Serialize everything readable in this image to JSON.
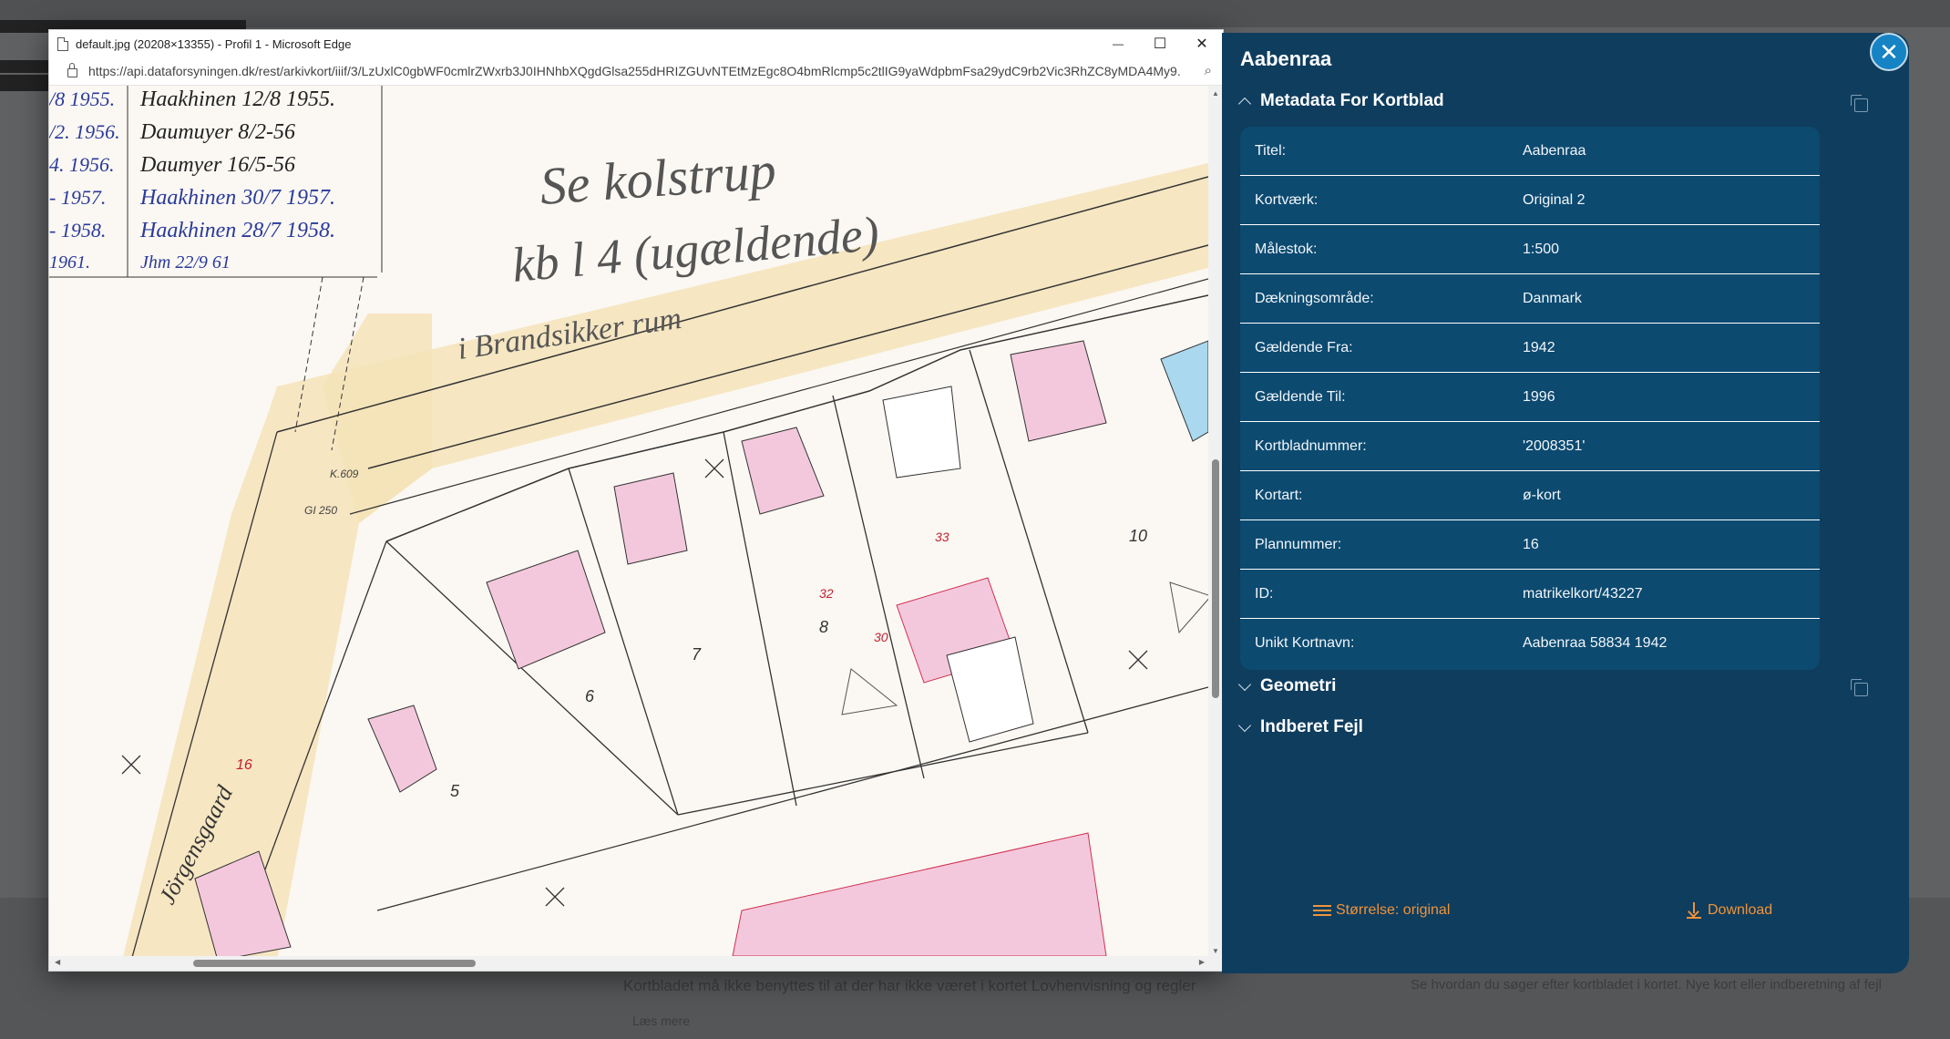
{
  "browser": {
    "title": "default.jpg (20208×13355) - Profil 1 - Microsoft Edge",
    "url": "https://api.dataforsyningen.dk/rest/arkivkort/iiif/3/LzUxlC0gbWF0cmlrZWxrb3J0IHNhbXQgdGlsa255dHRIZGUvNTEtMzEgc8O4bmRlcmp5c2tlIG9yaWdpbmFsa29ydC9rb2Vic3RhZC8yMDA4My9...",
    "controls": {
      "minimize": "—",
      "maximize": "☐",
      "close": "✕"
    }
  },
  "map": {
    "heading": "Se kolstrup",
    "subheading": "kb l 4 (ugældende)",
    "note": "i Brandsikker rum",
    "street": "Jörgensgaard",
    "plots": [
      "6",
      "7",
      "8",
      "10",
      "5",
      "16"
    ],
    "small_labels": [
      "32",
      "30",
      "33",
      "K.609",
      "GI 250"
    ],
    "log_entries": [
      {
        "date": "/8 1955.",
        "sign": "Haakhinen 12/8 1955."
      },
      {
        "date": "/2. 1956.",
        "sign": "Daumuyer 8/2-56"
      },
      {
        "date": "4. 1956.",
        "sign": "Daumyer 16/5-56"
      },
      {
        "date": "- 1957.",
        "sign": "Haakhinen 30/7 1957."
      },
      {
        "date": "- 1958.",
        "sign": "Haakhinen 28/7 1958."
      },
      {
        "date": "1961.",
        "sign": "Jhm 22/9 61"
      }
    ]
  },
  "panel": {
    "title": "Aabenraa",
    "sections": {
      "metadata": "Metadata For Kortblad",
      "geometry": "Geometri",
      "errors": "Indberet Fejl"
    },
    "rows": [
      {
        "key": "Titel:",
        "value": "Aabenraa"
      },
      {
        "key": "Kortværk:",
        "value": "Original 2"
      },
      {
        "key": "Målestok:",
        "value": "1:500"
      },
      {
        "key": "Dækningsområde:",
        "value": "Danmark"
      },
      {
        "key": "Gældende Fra:",
        "value": "1942"
      },
      {
        "key": "Gældende Til:",
        "value": "1996"
      },
      {
        "key": "Kortbladnummer:",
        "value": "'2008351'"
      },
      {
        "key": "Kortart:",
        "value": "ø-kort"
      },
      {
        "key": "Plannummer:",
        "value": "16"
      },
      {
        "key": "ID:",
        "value": "matrikelkort/43227"
      },
      {
        "key": "Unikt Kortnavn:",
        "value": "Aabenraa 58834 1942"
      }
    ],
    "size_button": "Størrelse: original",
    "download_button": "Download"
  },
  "background": {
    "footer_left": "Kortbladet må ikke benyttes til at der har ikke været i kortet Lovhenvisning og regler",
    "footer_right": "Se hvordan du søger efter kortbladet i kortet. Nye kort eller indberetning af fejl",
    "footer_link": "Læs mere"
  },
  "icons": {
    "doc": "document-icon",
    "lock": "lock-icon",
    "zoom": "zoom-icon",
    "close": "close-icon",
    "copy": "copy-icon",
    "menu": "menu-icon",
    "download": "download-icon"
  },
  "colors": {
    "panel": "#0f3d5e",
    "table": "#0c4a70",
    "accent": "#f0933a",
    "close": "#1583c4"
  }
}
